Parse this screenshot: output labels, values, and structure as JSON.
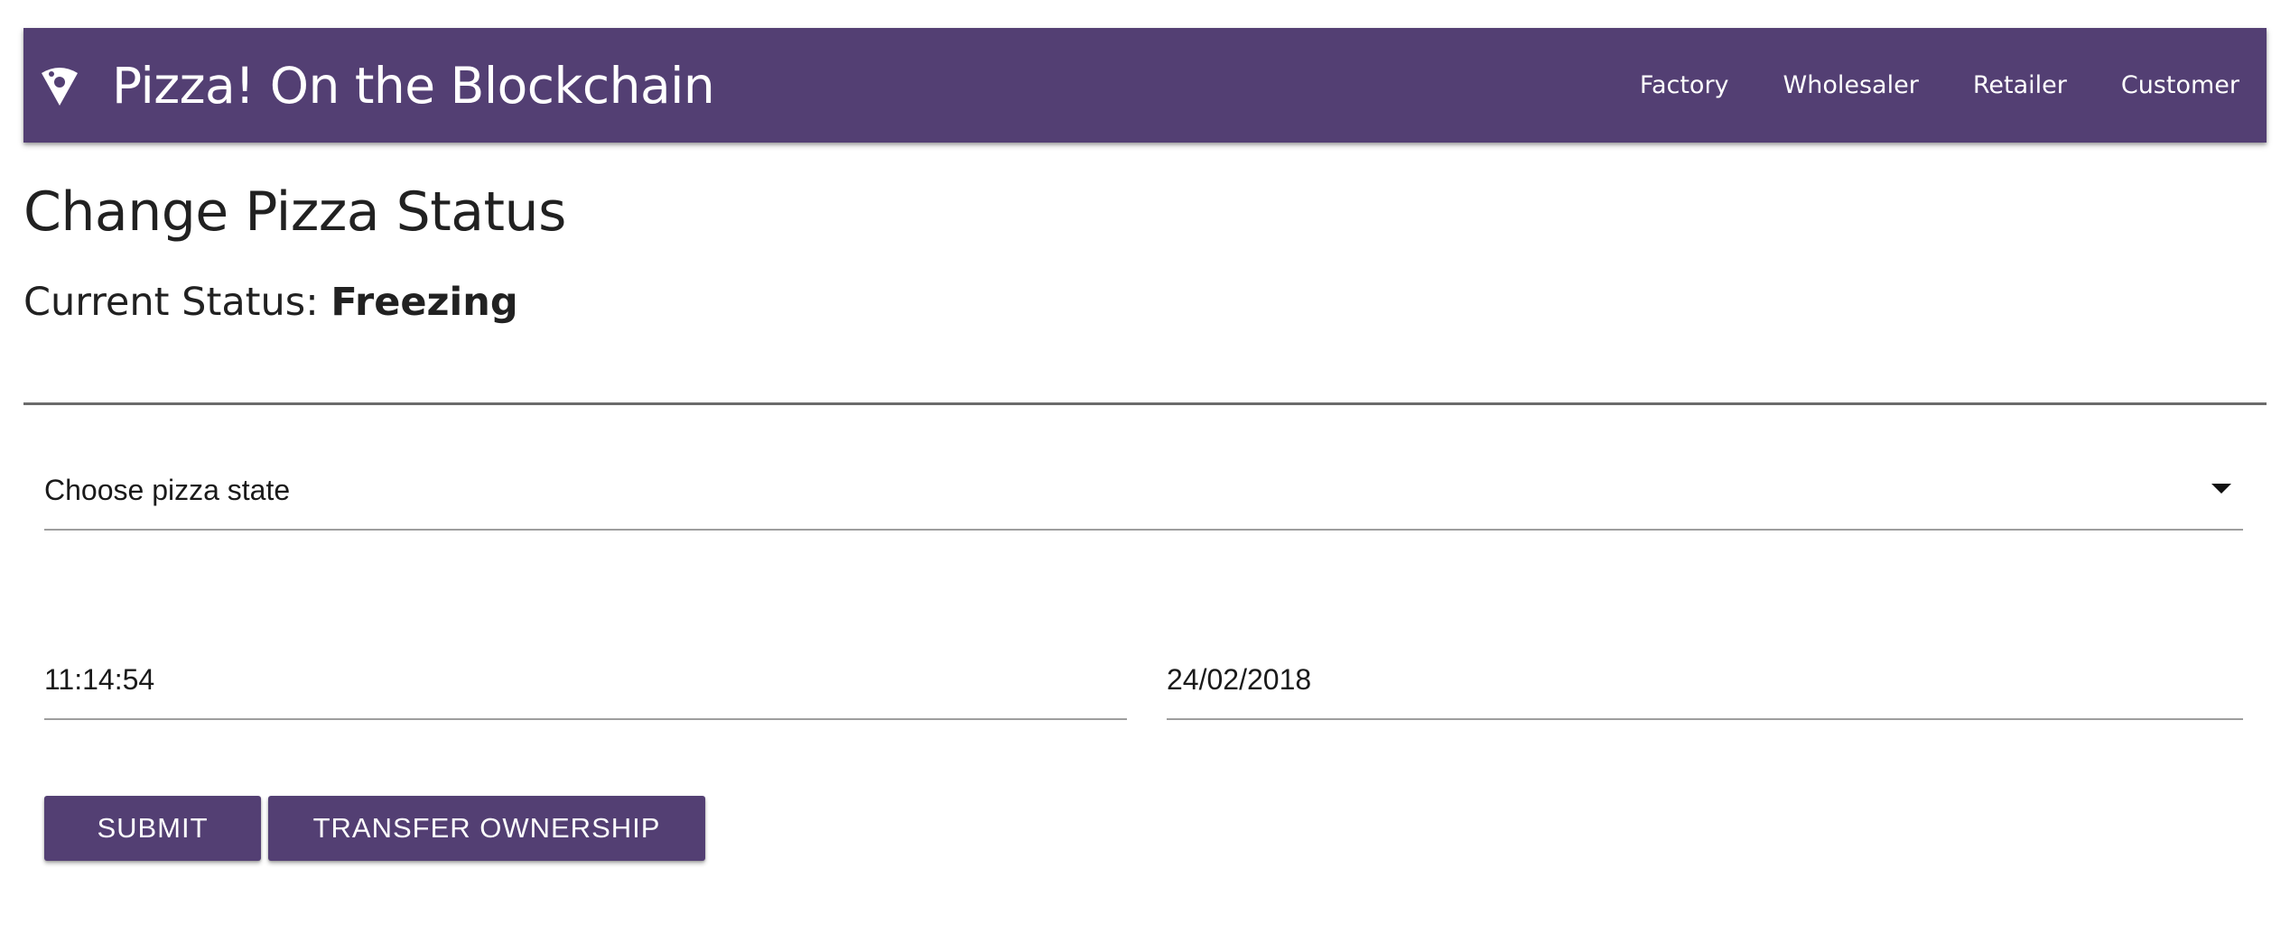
{
  "brand": {
    "icon": "pizza-slice-icon",
    "title": "Pizza! On the Blockchain"
  },
  "nav": {
    "items": [
      {
        "label": "Factory"
      },
      {
        "label": "Wholesaler"
      },
      {
        "label": "Retailer"
      },
      {
        "label": "Customer"
      }
    ]
  },
  "page": {
    "title": "Change Pizza Status",
    "current_status_label": "Current Status:",
    "current_status_value": "Freezing"
  },
  "form": {
    "state_select": {
      "placeholder": "Choose pizza state",
      "icon": "caret-down-icon"
    },
    "time_value": "11:14:54",
    "date_value": "24/02/2018"
  },
  "buttons": {
    "submit": "SUBMIT",
    "transfer": "TRANSFER OWNERSHIP"
  },
  "colors": {
    "primary": "#533f73",
    "text": "#212121",
    "on_primary": "#ffffff"
  }
}
